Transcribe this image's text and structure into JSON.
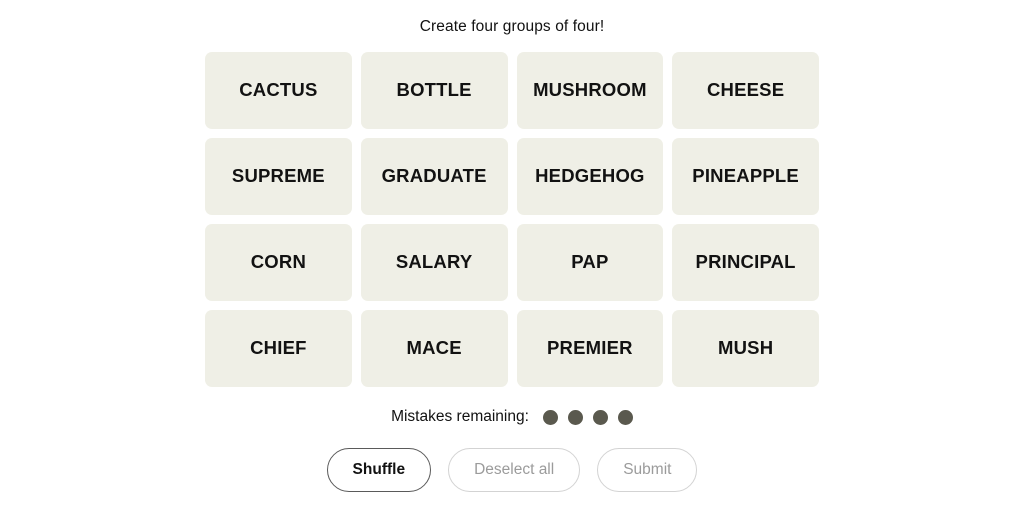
{
  "instruction": "Create four groups of four!",
  "board": {
    "rows": [
      [
        "CACTUS",
        "BOTTLE",
        "MUSHROOM",
        "CHEESE"
      ],
      [
        "SUPREME",
        "GRADUATE",
        "HEDGEHOG",
        "PINEAPPLE"
      ],
      [
        "CORN",
        "SALARY",
        "PAP",
        "PRINCIPAL"
      ],
      [
        "CHIEF",
        "MACE",
        "PREMIER",
        "MUSH"
      ]
    ]
  },
  "mistakes": {
    "label": "Mistakes remaining:",
    "remaining": 4,
    "dot_color": "#5a594e"
  },
  "actions": {
    "shuffle_label": "Shuffle",
    "deselect_label": "Deselect all",
    "submit_label": "Submit"
  },
  "colors": {
    "tile_background": "#efefe6",
    "page_background": "#ffffff",
    "text": "#121212",
    "disabled_text": "#9b9b9b",
    "disabled_border": "#d3d3d3"
  }
}
